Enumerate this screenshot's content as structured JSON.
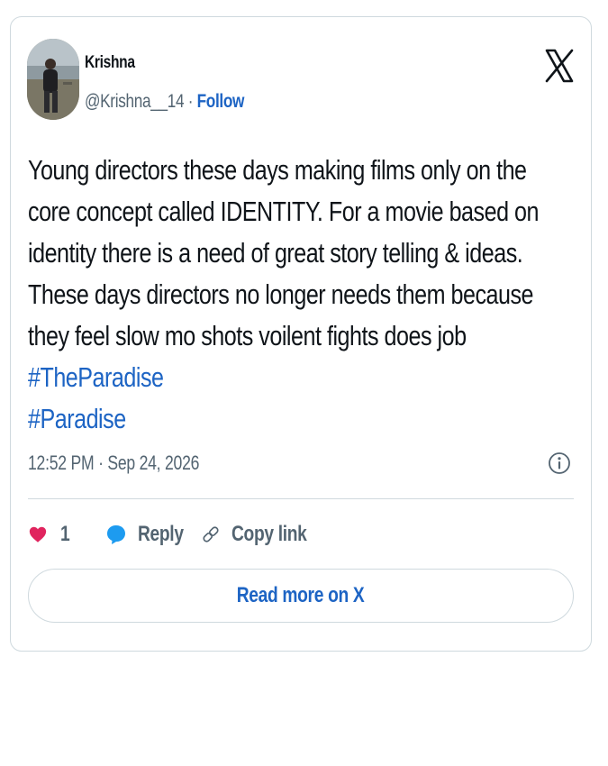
{
  "author": {
    "name": "Krishna",
    "handle": "@Krishna__14",
    "separator": "·",
    "follow_label": "Follow"
  },
  "icons": {
    "logo": "x-logo-icon",
    "info": "info-icon",
    "like": "heart-icon",
    "reply": "reply-bubble-icon",
    "copy": "link-icon"
  },
  "tweet": {
    "text": "Young directors these days making films only on the core concept called IDENTITY. For a movie based on identity there is a need of great story telling & ideas. These days directors no longer needs them because they feel slow mo shots voilent fights does job",
    "hashtags": [
      "#TheParadise",
      "#Paradise"
    ],
    "timestamp": "12:52 PM · Sep 24, 2026"
  },
  "actions": {
    "like_count": "1",
    "reply_label": "Reply",
    "copy_link_label": "Copy link"
  },
  "read_more_label": "Read more on X",
  "colors": {
    "link": "#1d64c4",
    "like": "#e0245e",
    "reply": "#1d9bf0",
    "muted": "#536471",
    "border": "#cfd9de"
  }
}
